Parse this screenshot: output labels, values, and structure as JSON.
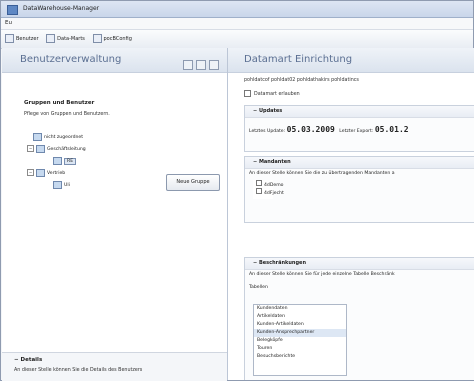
{
  "window": {
    "title": "DataWarehouse-Manager"
  },
  "menubar": {
    "items": [
      "Eu"
    ]
  },
  "toolbar": {
    "items": [
      "Benutzer",
      "Data-Marts",
      "pocBConfig"
    ]
  },
  "left": {
    "title": "Benutzerverwaltung",
    "groups_title": "Gruppen und Benutzer",
    "groups_desc": "Pflege von Gruppen und Benutzern.",
    "tree": [
      "nicht zugeordnet",
      "Geschäftsleitung",
      "RE",
      "Vertrieb",
      "Uli"
    ],
    "new_group_button": "Neue Gruppe",
    "details_title": "Details",
    "details_desc": "An dieser Stelle können Sie die Details des Benutzers"
  },
  "right": {
    "title": "Datamart Einrichtung",
    "path": "pohldatcof  pohldat02 pohldathakirs  pohldatincs",
    "checkbox_label": "Datamart erlauben",
    "updates": {
      "title": "Updates",
      "last_update_label": "Letztes Update:",
      "last_update_value": "05.03.2009",
      "last_export_label": "Letzter Export:",
      "last_export_value": "05.01.2"
    },
    "mandanten": {
      "title": "Mandanten",
      "desc": "An dieser Stelle können Sie die zu übertragenden Mandanten a",
      "items": [
        "4dDemo",
        "4dFjecht"
      ]
    },
    "restrictions": {
      "title": "Beschränkungen",
      "desc": "An dieser Stelle können Sie für jede einzelne Tabelle Beschränk",
      "tables_label": "Tabellen",
      "tables": [
        "Kundendaten",
        "Artikeldaten",
        "Kunden-Artikeldaten",
        "Kunden-Ansprechpartner",
        "Belegköpfe",
        "Touren",
        "Besuchsberichte"
      ],
      "selected_index": 3
    }
  }
}
